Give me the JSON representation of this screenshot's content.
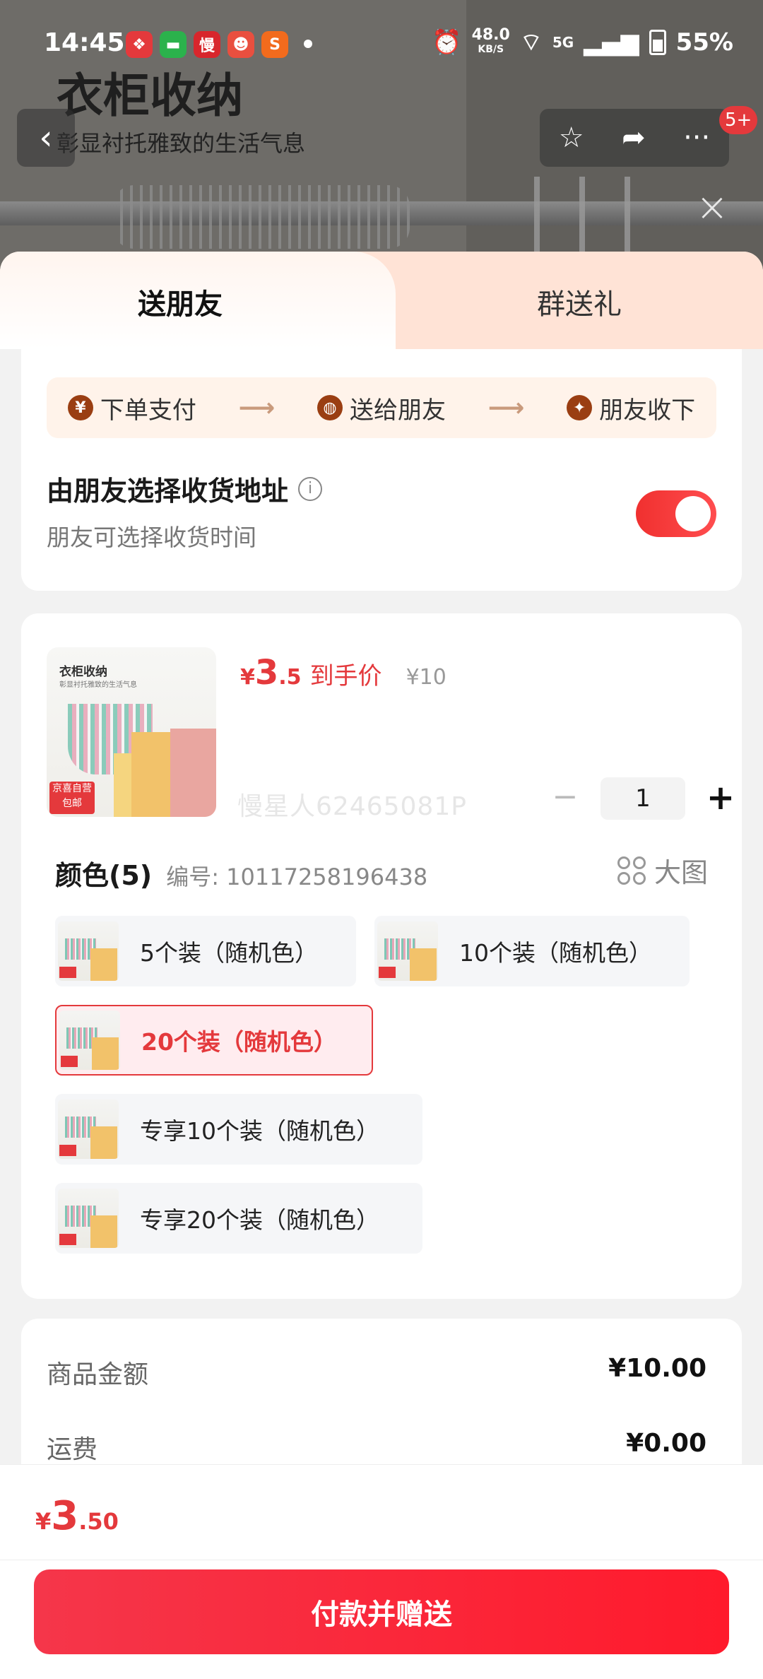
{
  "status_bar": {
    "time": "14:45",
    "net_speed_value": "48.0",
    "net_speed_unit": "KB/S",
    "signal_label": "5G",
    "battery": "55%"
  },
  "hero": {
    "title": "衣柜收纳",
    "subtitle": "彰显衬托雅致的生活气息",
    "cart_badge": "5+"
  },
  "tabs": {
    "active": "送朋友",
    "inactive": "群送礼"
  },
  "gift_steps": {
    "step1": "下单支付",
    "step2": "送给朋友",
    "step3": "朋友收下"
  },
  "address": {
    "title": "由朋友选择收货地址",
    "subtitle": "朋友可选择收货时间",
    "toggle_on": true
  },
  "product": {
    "image_title": "衣柜收纳",
    "image_subtitle": "彰显衬托雅致的生活气息",
    "image_tag_line1": "京喜自营",
    "image_tag_line2": "包邮",
    "price_symbol": "¥",
    "price_int": "3",
    "price_dec": ".5",
    "price_label": "到手价",
    "original_price": "¥10",
    "watermark": "慢星人62465081P",
    "quantity": "1"
  },
  "spec": {
    "title": "颜色(5)",
    "code": "编号: 10117258196438",
    "big_view_label": "大图",
    "options": [
      {
        "label": "5个装（随机色）",
        "selected": false
      },
      {
        "label": "10个装（随机色）",
        "selected": false
      },
      {
        "label": "20个装（随机色）",
        "selected": true
      },
      {
        "label": "专享10个装（随机色）",
        "selected": false
      },
      {
        "label": "专享20个装（随机色）",
        "selected": false
      }
    ]
  },
  "summary": {
    "goods_amount_label": "商品金额",
    "goods_amount_value": "¥10.00",
    "shipping_label": "运费",
    "shipping_value": "¥0.00"
  },
  "footer": {
    "total_symbol": "¥",
    "total_int": "3",
    "total_dec": ".50",
    "pay_button": "付款并赠送"
  },
  "colors": {
    "accent_red": "#e4393c",
    "step_icon_brown": "#9a3e12"
  }
}
